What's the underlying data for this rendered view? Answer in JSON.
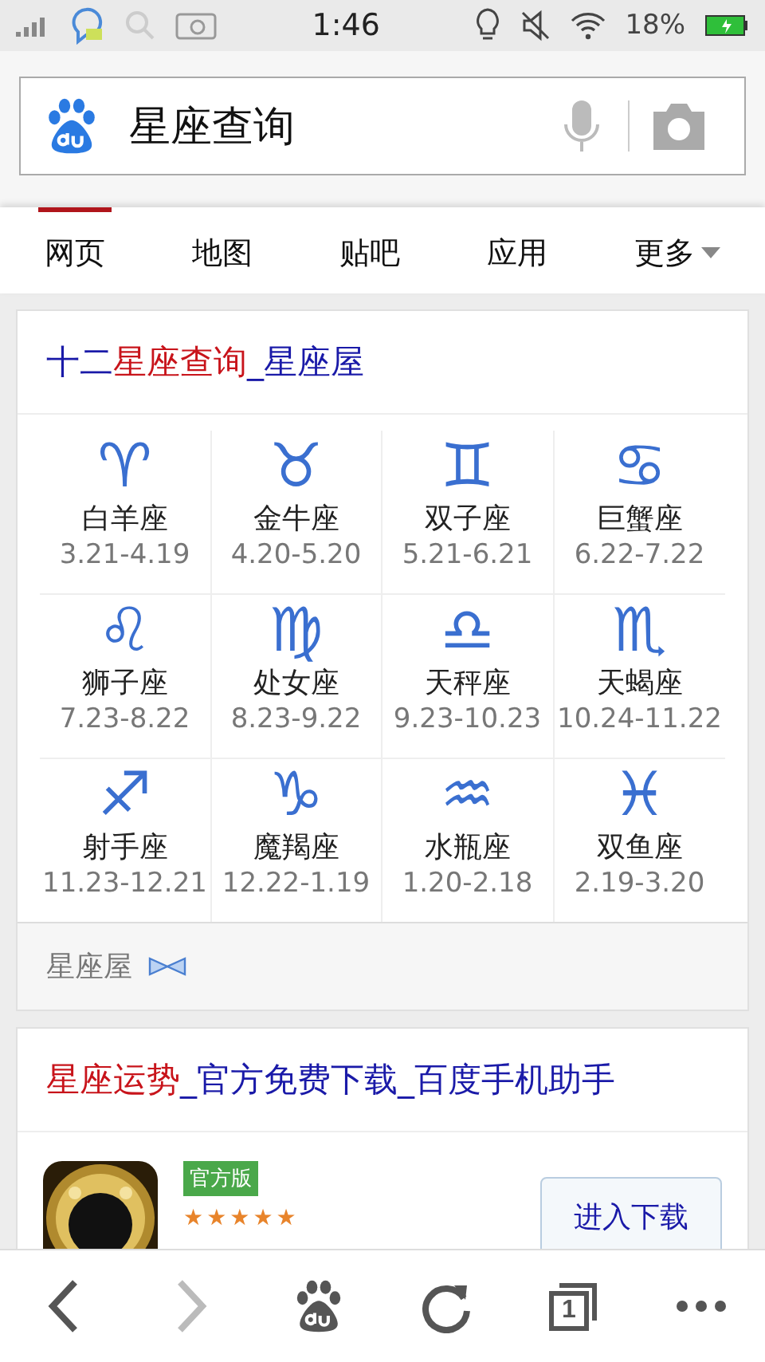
{
  "status_bar": {
    "time": "1:46",
    "battery": "18%"
  },
  "search": {
    "value": "星座查询"
  },
  "tabs": [
    {
      "label": "网页",
      "selected": true
    },
    {
      "label": "地图",
      "selected": false
    },
    {
      "label": "贴吧",
      "selected": false
    },
    {
      "label": "应用",
      "selected": false
    },
    {
      "label": "更多",
      "selected": false,
      "dropdown": true
    }
  ],
  "result_1": {
    "title": [
      {
        "text": "十二",
        "highlight": false
      },
      {
        "text": "星座查询",
        "highlight": true
      },
      {
        "text": "_星座屋",
        "highlight": false
      }
    ],
    "signs": [
      {
        "symbol": "♈",
        "name": "白羊座",
        "dates": "3.21-4.19"
      },
      {
        "symbol": "♉",
        "name": "金牛座",
        "dates": "4.20-5.20"
      },
      {
        "symbol": "♊",
        "name": "双子座",
        "dates": "5.21-6.21"
      },
      {
        "symbol": "♋",
        "name": "巨蟹座",
        "dates": "6.22-7.22"
      },
      {
        "symbol": "♌",
        "name": "狮子座",
        "dates": "7.23-8.22"
      },
      {
        "symbol": "♍",
        "name": "处女座",
        "dates": "8.23-9.22"
      },
      {
        "symbol": "♎",
        "name": "天秤座",
        "dates": "9.23-10.23"
      },
      {
        "symbol": "♏",
        "name": "天蝎座",
        "dates": "10.24-11.22"
      },
      {
        "symbol": "♐",
        "name": "射手座",
        "dates": "11.23-12.21"
      },
      {
        "symbol": "♑",
        "name": "魔羯座",
        "dates": "12.22-1.19"
      },
      {
        "symbol": "♒",
        "name": "水瓶座",
        "dates": "1.20-2.18"
      },
      {
        "symbol": "♓",
        "name": "双鱼座",
        "dates": "2.19-3.20"
      }
    ],
    "source": "星座屋"
  },
  "result_2": {
    "title": [
      {
        "text": "星座运势",
        "highlight": true
      },
      {
        "text": "_官方免费下载_百度手机助手",
        "highlight": false
      }
    ],
    "badge": "官方版",
    "stars": 5,
    "button": "进入下载"
  },
  "bottom_bar": {
    "tab_count": "1"
  }
}
